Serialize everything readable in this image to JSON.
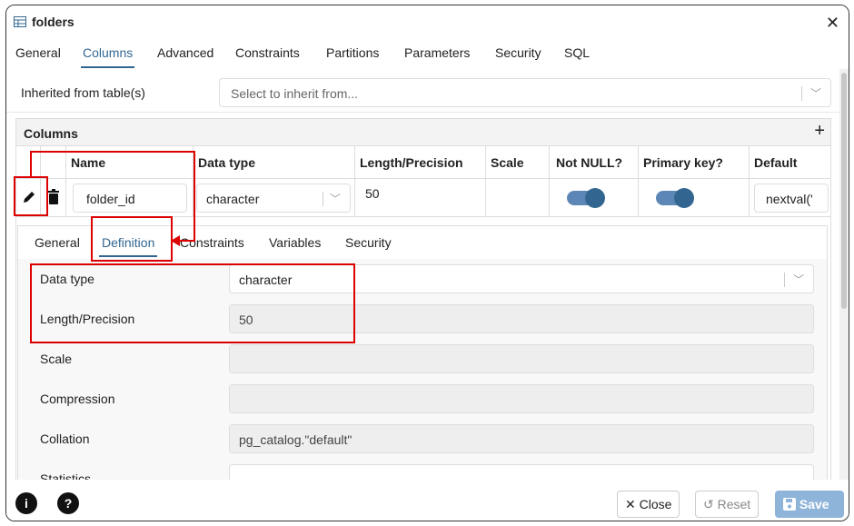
{
  "window": {
    "title": "folders",
    "close_glyph": "✕"
  },
  "tabs": [
    "General",
    "Columns",
    "Advanced",
    "Constraints",
    "Partitions",
    "Parameters",
    "Security",
    "SQL"
  ],
  "inherit": {
    "label": "Inherited from table(s)",
    "placeholder": "Select to inherit from..."
  },
  "columns": {
    "title": "Columns",
    "add_glyph": "+",
    "headers": [
      "Name",
      "Data type",
      "Length/Precision",
      "Scale",
      "Not NULL?",
      "Primary key?",
      "Default"
    ],
    "row": {
      "name": "folder_id",
      "data_type": "character",
      "length": "50",
      "scale": "",
      "not_null": true,
      "primary_key": true,
      "default": "nextval('"
    }
  },
  "subtabs": [
    "General",
    "Definition",
    "Constraints",
    "Variables",
    "Security"
  ],
  "definition": {
    "data_type_label": "Data type",
    "data_type_value": "character",
    "length_label": "Length/Precision",
    "length_value": "50",
    "scale_label": "Scale",
    "compression_label": "Compression",
    "collation_label": "Collation",
    "collation_value": "pg_catalog.\"default\"",
    "statistics_label": "Statistics"
  },
  "footer": {
    "info": "i",
    "help": "?",
    "close": "Close",
    "reset": "Reset",
    "save": "Save"
  },
  "colors": {
    "accent": "#326690",
    "annotation": "#dd0000"
  }
}
